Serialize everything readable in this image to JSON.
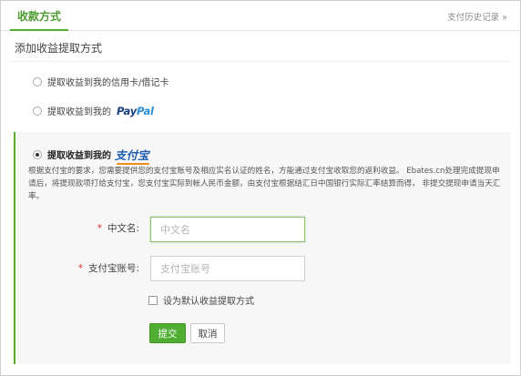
{
  "tabs": {
    "active_label": "收款方式",
    "history_link": "支付历史记录 »"
  },
  "section_title": "添加收益提取方式",
  "options": [
    {
      "label": "提取收益到我的信用卡/借记卡",
      "selected": false
    },
    {
      "label": "提取收益到我的",
      "logo_text_1": "Pay",
      "logo_text_2": "Pal",
      "selected": false
    },
    {
      "label": "提取收益到我的",
      "logo_text": "支付宝",
      "selected": true
    }
  ],
  "description": "根据支付宝的要求，您需要提供您的支付宝账号及相应实名认证的姓名，方能通过支付宝收取您的返利收益。 Ebates.cn处理完成提现申请后，将提现款项打给支付宝，您支付宝实际到帐人民币金额，由支付宝根据结汇日中国银行实际汇率结算而得， 非提交提现申请当天汇率。",
  "form": {
    "required_mark": "*",
    "name_label": "中文名:",
    "name_placeholder": "中文名",
    "name_value": "",
    "account_label": "支付宝账号:",
    "account_placeholder": "支付宝账号",
    "account_value": "",
    "default_checkbox_label": "设为默认收益提取方式",
    "default_checked": false,
    "submit_label": "提交",
    "cancel_label": "取消"
  },
  "colors": {
    "accent": "#4fae32",
    "required": "#e0322e",
    "paypal_dark": "#1c3f7e",
    "paypal_light": "#2a8fd8",
    "alipay_blue": "#1f5fb0"
  }
}
